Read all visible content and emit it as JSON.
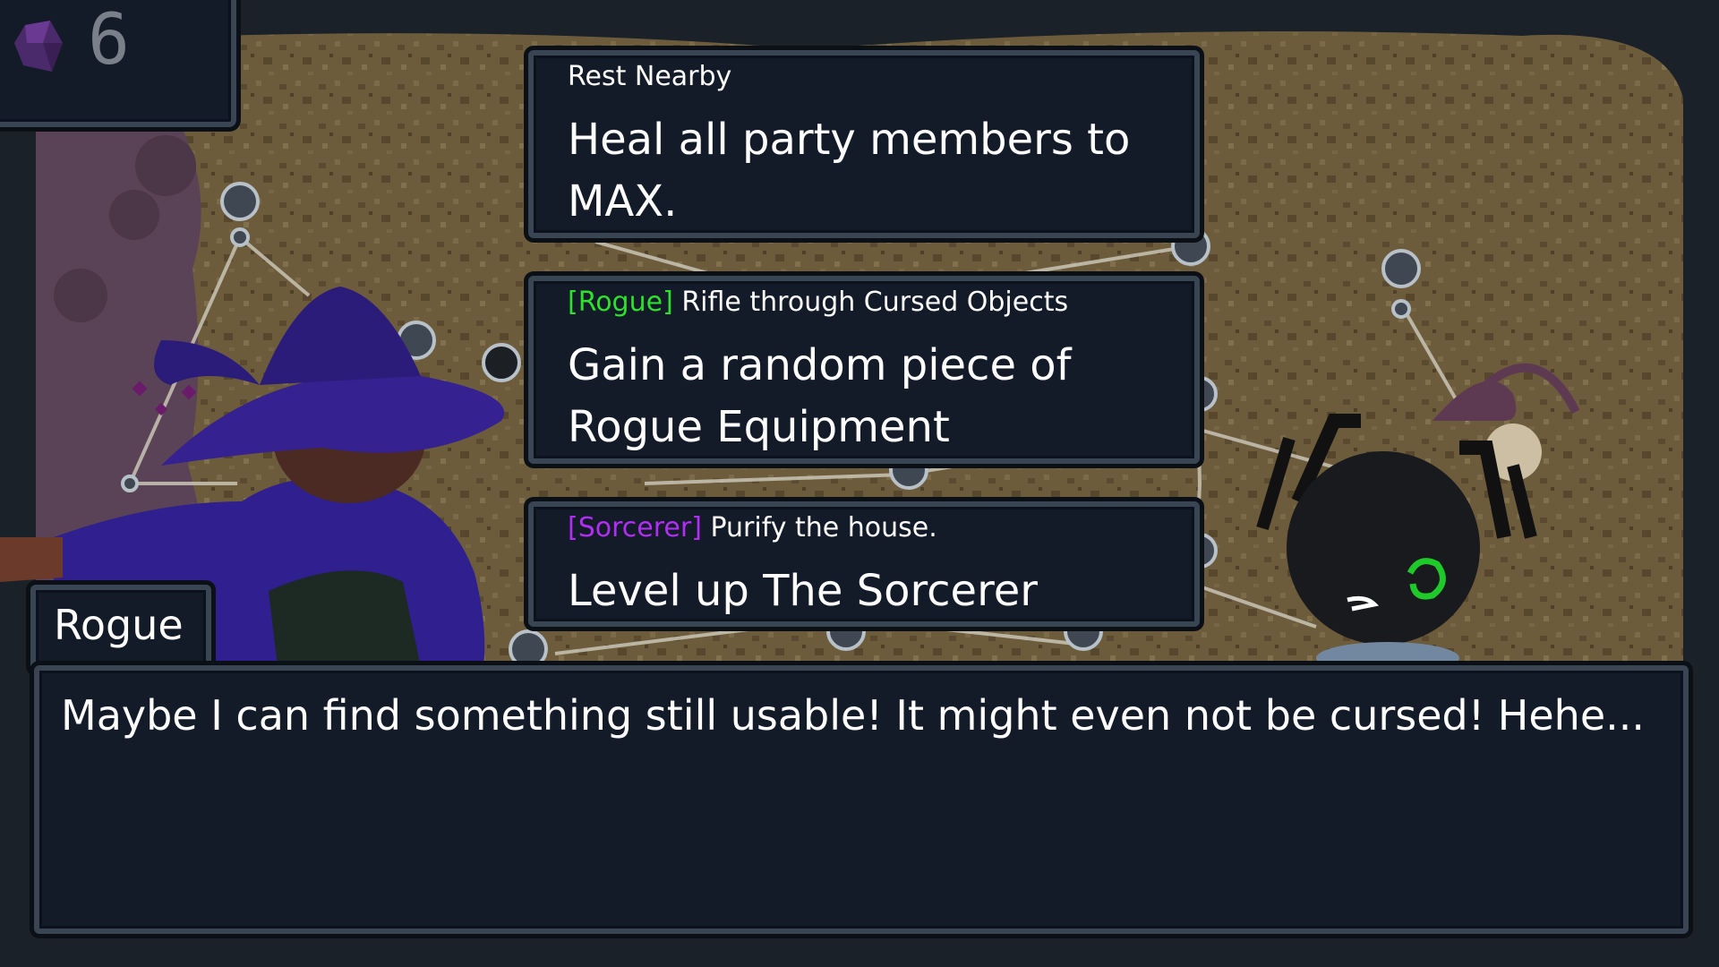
{
  "hud": {
    "crystal_icon": "purple-crystal-icon",
    "crystal_count": "6"
  },
  "choices": [
    {
      "tag": "",
      "title": "Rest Nearby",
      "effect": "Heal all party members to MAX."
    },
    {
      "tag": "[Rogue]",
      "tag_color": "#2ee02e",
      "title": "Rifle through Cursed Objects",
      "effect": "Gain a random piece of Rogue Equipment"
    },
    {
      "tag": "[Sorcerer]",
      "tag_color": "#b02ef5",
      "title": "Purify the house.",
      "effect": "Level up The Sorcerer"
    }
  ],
  "dialog": {
    "speaker": "Rogue",
    "text": "Maybe I can find something still usable! It might even not be cursed! Hehe..."
  },
  "colors": {
    "panel_bg": "#131a28",
    "panel_border": "#3a4554",
    "map_ground": "#6e5d3d",
    "witch_robe": "#2f1f8f",
    "rogue_tag": "#2ee02e",
    "sorcerer_tag": "#b02ef5"
  }
}
